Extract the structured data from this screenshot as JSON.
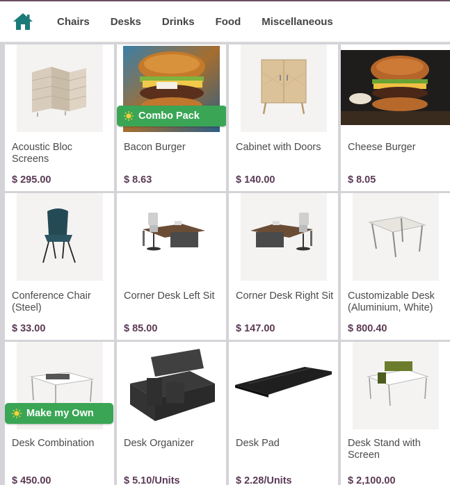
{
  "nav": {
    "home_icon": "home-icon",
    "items": [
      "Chairs",
      "Desks",
      "Drinks",
      "Food",
      "Miscellaneous"
    ]
  },
  "colors": {
    "accent": "#1b7b79",
    "price": "#5b3a55",
    "ribbon": "#3aa655"
  },
  "products": [
    {
      "name": "Acoustic Bloc Screens",
      "price": "$ 295.00"
    },
    {
      "name": "Bacon Burger",
      "price": "$ 8.63",
      "ribbon": "Combo Pack"
    },
    {
      "name": "Cabinet with Doors",
      "price": "$ 140.00"
    },
    {
      "name": "Cheese Burger",
      "price": "$ 8.05"
    },
    {
      "name": "Conference Chair (Steel)",
      "price": "$ 33.00"
    },
    {
      "name": "Corner Desk Left Sit",
      "price": "$ 85.00"
    },
    {
      "name": "Corner Desk Right Sit",
      "price": "$ 147.00"
    },
    {
      "name": "Customizable Desk (Aluminium, White)",
      "price": "$ 800.40"
    },
    {
      "name": "Desk Combination",
      "price": "$ 450.00",
      "ribbon": "Make my Own"
    },
    {
      "name": "Desk Organizer",
      "price": "$ 5.10/Units"
    },
    {
      "name": "Desk Pad",
      "price": "$ 2.28/Units"
    },
    {
      "name": "Desk Stand with Screen",
      "price": "$ 2,100.00"
    }
  ]
}
